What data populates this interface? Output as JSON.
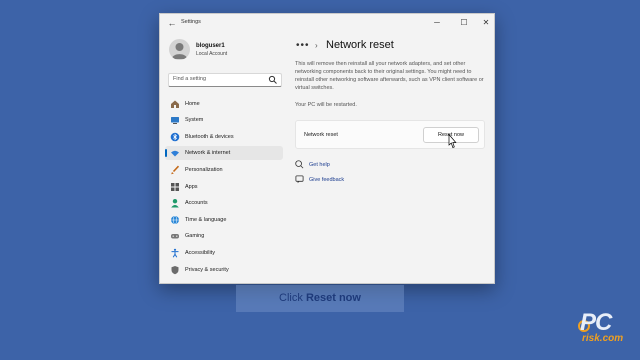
{
  "window": {
    "title": "Settings",
    "controls": {
      "minimize": "─",
      "maximize": "☐",
      "close": "✕"
    }
  },
  "user": {
    "name": "bloguser1",
    "type": "Local Account"
  },
  "search": {
    "placeholder": "Find a setting"
  },
  "nav": [
    {
      "label": "Home",
      "icon": "home-icon",
      "active": false
    },
    {
      "label": "System",
      "icon": "system-icon",
      "active": false
    },
    {
      "label": "Bluetooth & devices",
      "icon": "bluetooth-icon",
      "active": false
    },
    {
      "label": "Network & internet",
      "icon": "wifi-icon",
      "active": true
    },
    {
      "label": "Personalization",
      "icon": "brush-icon",
      "active": false
    },
    {
      "label": "Apps",
      "icon": "apps-icon",
      "active": false
    },
    {
      "label": "Accounts",
      "icon": "accounts-icon",
      "active": false
    },
    {
      "label": "Time & language",
      "icon": "globe-icon",
      "active": false
    },
    {
      "label": "Gaming",
      "icon": "gamepad-icon",
      "active": false
    },
    {
      "label": "Accessibility",
      "icon": "accessibility-icon",
      "active": false
    },
    {
      "label": "Privacy & security",
      "icon": "shield-icon",
      "active": false
    }
  ],
  "breadcrumb": {
    "more": "•••",
    "separator": "›",
    "title": "Network reset"
  },
  "main": {
    "description": "This will remove then reinstall all your network adapters, and set other networking components back to their original settings. You might need to reinstall other networking software afterwards, such as VPN client software or virtual switches.",
    "restart_note": "Your PC will be restarted.",
    "card_label": "Network reset",
    "reset_button": "Reset now",
    "get_help": "Get help",
    "give_feedback": "Give feedback"
  },
  "caption": {
    "prefix": "Click",
    "bold": "Reset now"
  },
  "logo": {
    "pc": "PC",
    "risk": "risk.com"
  },
  "colors": {
    "accent": "#0067c0",
    "background": "#3d63a8"
  }
}
